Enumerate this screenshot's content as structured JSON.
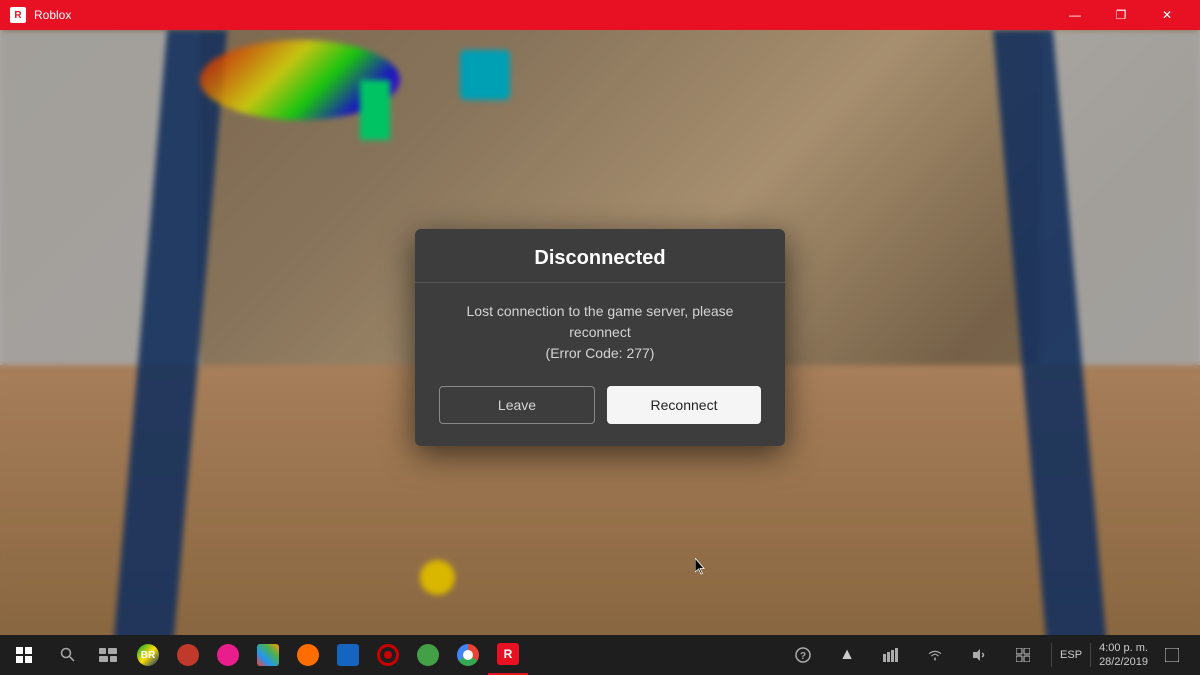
{
  "titleBar": {
    "appName": "Roblox",
    "minimizeLabel": "—",
    "maximizeLabel": "❐",
    "closeLabel": "✕"
  },
  "dialog": {
    "title": "Disconnected",
    "message": "Lost connection to the game server, please reconnect\n(Error Code: 277)",
    "leaveButton": "Leave",
    "reconnectButton": "Reconnect"
  },
  "taskbar": {
    "time": "4:00 p. m.",
    "date": "28/2/2019",
    "language": "ESP"
  }
}
